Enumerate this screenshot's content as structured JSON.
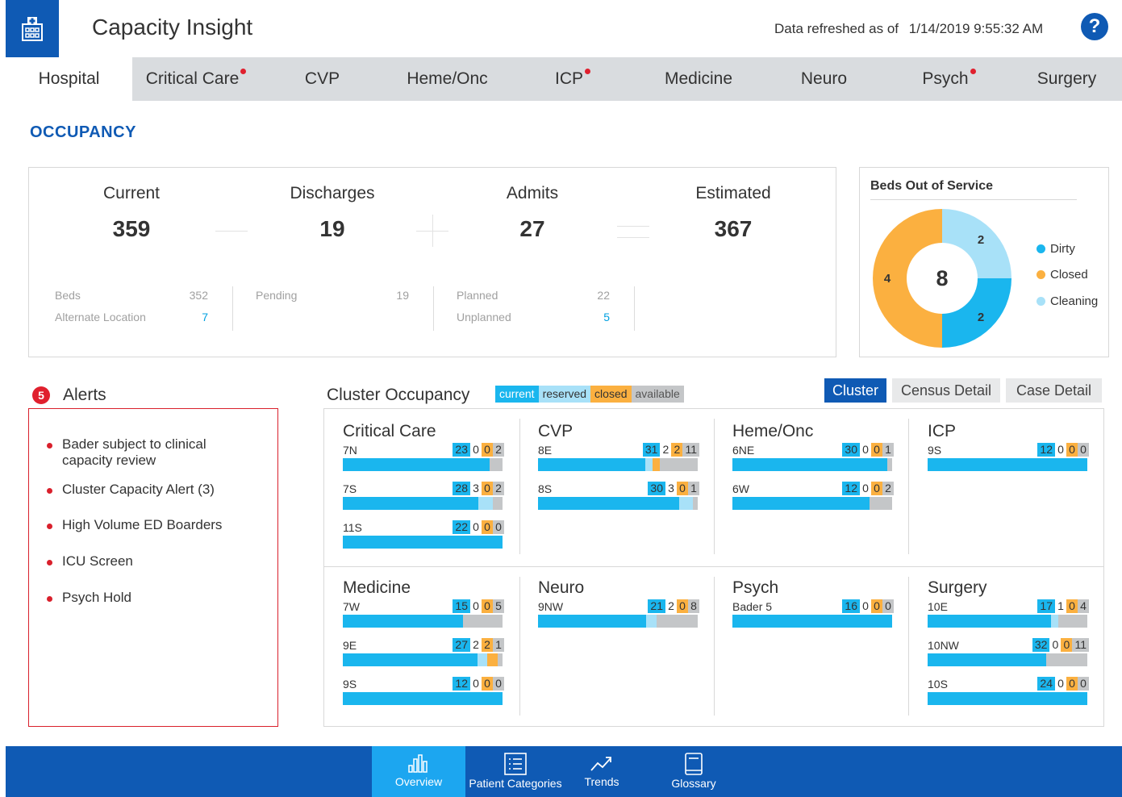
{
  "header": {
    "title": "Capacity Insight",
    "refresh_label": "Data refreshed as of",
    "refresh_time": "1/14/2019 9:55:32 AM",
    "help": "?"
  },
  "tabs": [
    {
      "label": "Hospital",
      "active": true,
      "alert": false
    },
    {
      "label": "Critical Care",
      "active": false,
      "alert": true
    },
    {
      "label": "CVP",
      "active": false,
      "alert": false
    },
    {
      "label": "Heme/Onc",
      "active": false,
      "alert": false
    },
    {
      "label": "ICP",
      "active": false,
      "alert": true
    },
    {
      "label": "Medicine",
      "active": false,
      "alert": false
    },
    {
      "label": "Neuro",
      "active": false,
      "alert": false
    },
    {
      "label": "Psych",
      "active": false,
      "alert": true
    },
    {
      "label": "Surgery",
      "active": false,
      "alert": false
    }
  ],
  "occupancy": {
    "title": "OCCUPANCY",
    "current": {
      "label": "Current",
      "value": "359"
    },
    "discharges": {
      "label": "Discharges",
      "value": "19"
    },
    "admits": {
      "label": "Admits",
      "value": "27"
    },
    "estimated": {
      "label": "Estimated",
      "value": "367"
    },
    "details": {
      "beds_label": "Beds",
      "beds": "352",
      "alt_label": "Alternate Location",
      "alt": "7",
      "pending_label": "Pending",
      "pending": "19",
      "planned_label": "Planned",
      "planned": "22",
      "unplanned_label": "Unplanned",
      "unplanned": "5"
    }
  },
  "beds_out_of_service": {
    "title": "Beds Out of Service",
    "total": "8",
    "segments": [
      {
        "name": "Dirty",
        "value": 2,
        "color": "#1ab6ee"
      },
      {
        "name": "Closed",
        "value": 4,
        "color": "#fbb040"
      },
      {
        "name": "Cleaning",
        "value": 2,
        "color": "#a8e1f8"
      }
    ]
  },
  "alerts": {
    "count": "5",
    "title": "Alerts",
    "items": [
      "Bader subject to clinical capacity review",
      "Cluster Capacity Alert (3)",
      "High Volume ED Boarders",
      "ICU Screen",
      "Psych Hold"
    ]
  },
  "cluster_occupancy": {
    "title": "Cluster Occupancy",
    "legend": [
      {
        "label": "current",
        "color": "#1ab6ee"
      },
      {
        "label": "reserved",
        "color": "#a8e1f8"
      },
      {
        "label": "closed",
        "color": "#fbb040"
      },
      {
        "label": "available",
        "color": "#c4c6c8"
      }
    ],
    "views": [
      {
        "label": "Cluster",
        "active": true
      },
      {
        "label": "Census Detail",
        "active": false
      },
      {
        "label": "Case Detail",
        "active": false
      }
    ],
    "clusters": [
      {
        "name": "Critical Care",
        "units": [
          {
            "name": "7N",
            "current": 23,
            "reserved": 0,
            "closed": 0,
            "available": 2
          },
          {
            "name": "7S",
            "current": 28,
            "reserved": 3,
            "closed": 0,
            "available": 2
          },
          {
            "name": "11S",
            "current": 22,
            "reserved": 0,
            "closed": 0,
            "available": 0
          }
        ]
      },
      {
        "name": "CVP",
        "units": [
          {
            "name": "8E",
            "current": 31,
            "reserved": 2,
            "closed": 2,
            "available": 11
          },
          {
            "name": "8S",
            "current": 30,
            "reserved": 3,
            "closed": 0,
            "available": 1
          }
        ]
      },
      {
        "name": "Heme/Onc",
        "units": [
          {
            "name": "6NE",
            "current": 30,
            "reserved": 0,
            "closed": 0,
            "available": 1
          },
          {
            "name": "6W",
            "current": 12,
            "reserved": 0,
            "closed": 0,
            "available": 2
          }
        ]
      },
      {
        "name": "ICP",
        "units": [
          {
            "name": "9S",
            "current": 12,
            "reserved": 0,
            "closed": 0,
            "available": 0
          }
        ]
      },
      {
        "name": "Medicine",
        "units": [
          {
            "name": "7W",
            "current": 15,
            "reserved": 0,
            "closed": 0,
            "available": 5
          },
          {
            "name": "9E",
            "current": 27,
            "reserved": 2,
            "closed": 2,
            "available": 1
          },
          {
            "name": "9S",
            "current": 12,
            "reserved": 0,
            "closed": 0,
            "available": 0
          }
        ]
      },
      {
        "name": "Neuro",
        "units": [
          {
            "name": "9NW",
            "current": 21,
            "reserved": 2,
            "closed": 0,
            "available": 8
          }
        ]
      },
      {
        "name": "Psych",
        "units": [
          {
            "name": "Bader 5",
            "current": 16,
            "reserved": 0,
            "closed": 0,
            "available": 0
          }
        ]
      },
      {
        "name": "Surgery",
        "units": [
          {
            "name": "10E",
            "current": 17,
            "reserved": 1,
            "closed": 0,
            "available": 4
          },
          {
            "name": "10NW",
            "current": 32,
            "reserved": 0,
            "closed": 0,
            "available": 11
          },
          {
            "name": "10S",
            "current": 24,
            "reserved": 0,
            "closed": 0,
            "available": 0
          }
        ]
      }
    ]
  },
  "footer": {
    "items": [
      {
        "label": "Overview",
        "icon": "bar-chart-icon",
        "active": true
      },
      {
        "label": "Patient Categories",
        "icon": "list-icon",
        "active": false
      },
      {
        "label": "Trends",
        "icon": "trend-icon",
        "active": false
      },
      {
        "label": "Glossary",
        "icon": "book-icon",
        "active": false
      }
    ]
  }
}
